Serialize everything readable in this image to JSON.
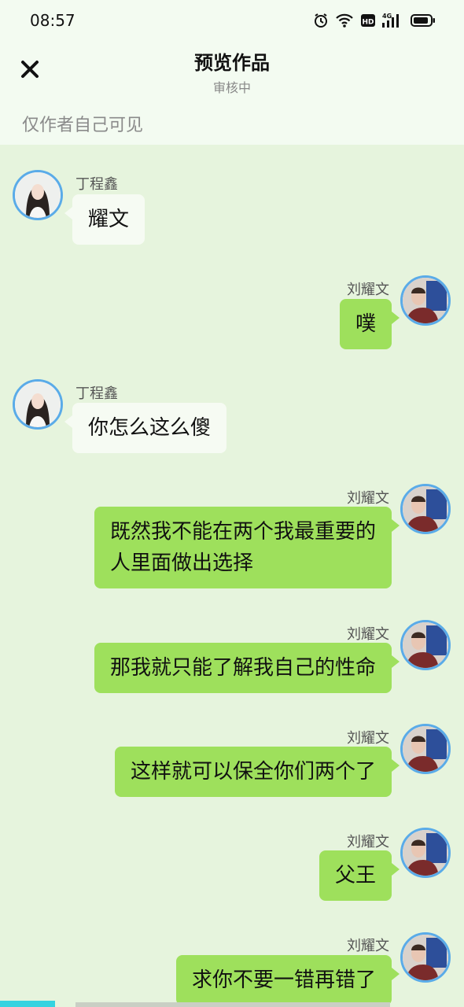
{
  "status_bar": {
    "time": "08:57",
    "icons": [
      "alarm-icon",
      "wifi-icon",
      "hd-icon",
      "4g-signal-icon",
      "battery-icon"
    ],
    "hd_text": "HD",
    "network_text": "4G"
  },
  "header": {
    "title": "预览作品",
    "subtitle": "审核中",
    "visibility_note": "仅作者自己可见",
    "close_icon": "close-icon"
  },
  "colors": {
    "header_bg": "#f3fbf1",
    "chat_bg": "#e6f4dd",
    "bubble_right": "#9ee05c",
    "bubble_left": "#f6fbf3",
    "avatar_border": "#5aabe8"
  },
  "messages": [
    {
      "sender": "丁程鑫",
      "side": "left",
      "lines": [
        "耀文"
      ]
    },
    {
      "sender": "刘耀文",
      "side": "right",
      "lines": [
        "噗"
      ]
    },
    {
      "sender": "丁程鑫",
      "side": "left",
      "lines": [
        "你怎么这么傻"
      ]
    },
    {
      "sender": "刘耀文",
      "side": "right",
      "lines": [
        "既然我不能在两个我最重要的",
        "人里面做出选择"
      ]
    },
    {
      "sender": "刘耀文",
      "side": "right",
      "lines": [
        "那我就只能了解我自己的性命"
      ]
    },
    {
      "sender": "刘耀文",
      "side": "right",
      "lines": [
        "这样就可以保全你们两个了"
      ]
    },
    {
      "sender": "刘耀文",
      "side": "right",
      "lines": [
        "父王"
      ]
    },
    {
      "sender": "刘耀文",
      "side": "right",
      "lines": [
        "求你不要一错再错了"
      ]
    }
  ]
}
